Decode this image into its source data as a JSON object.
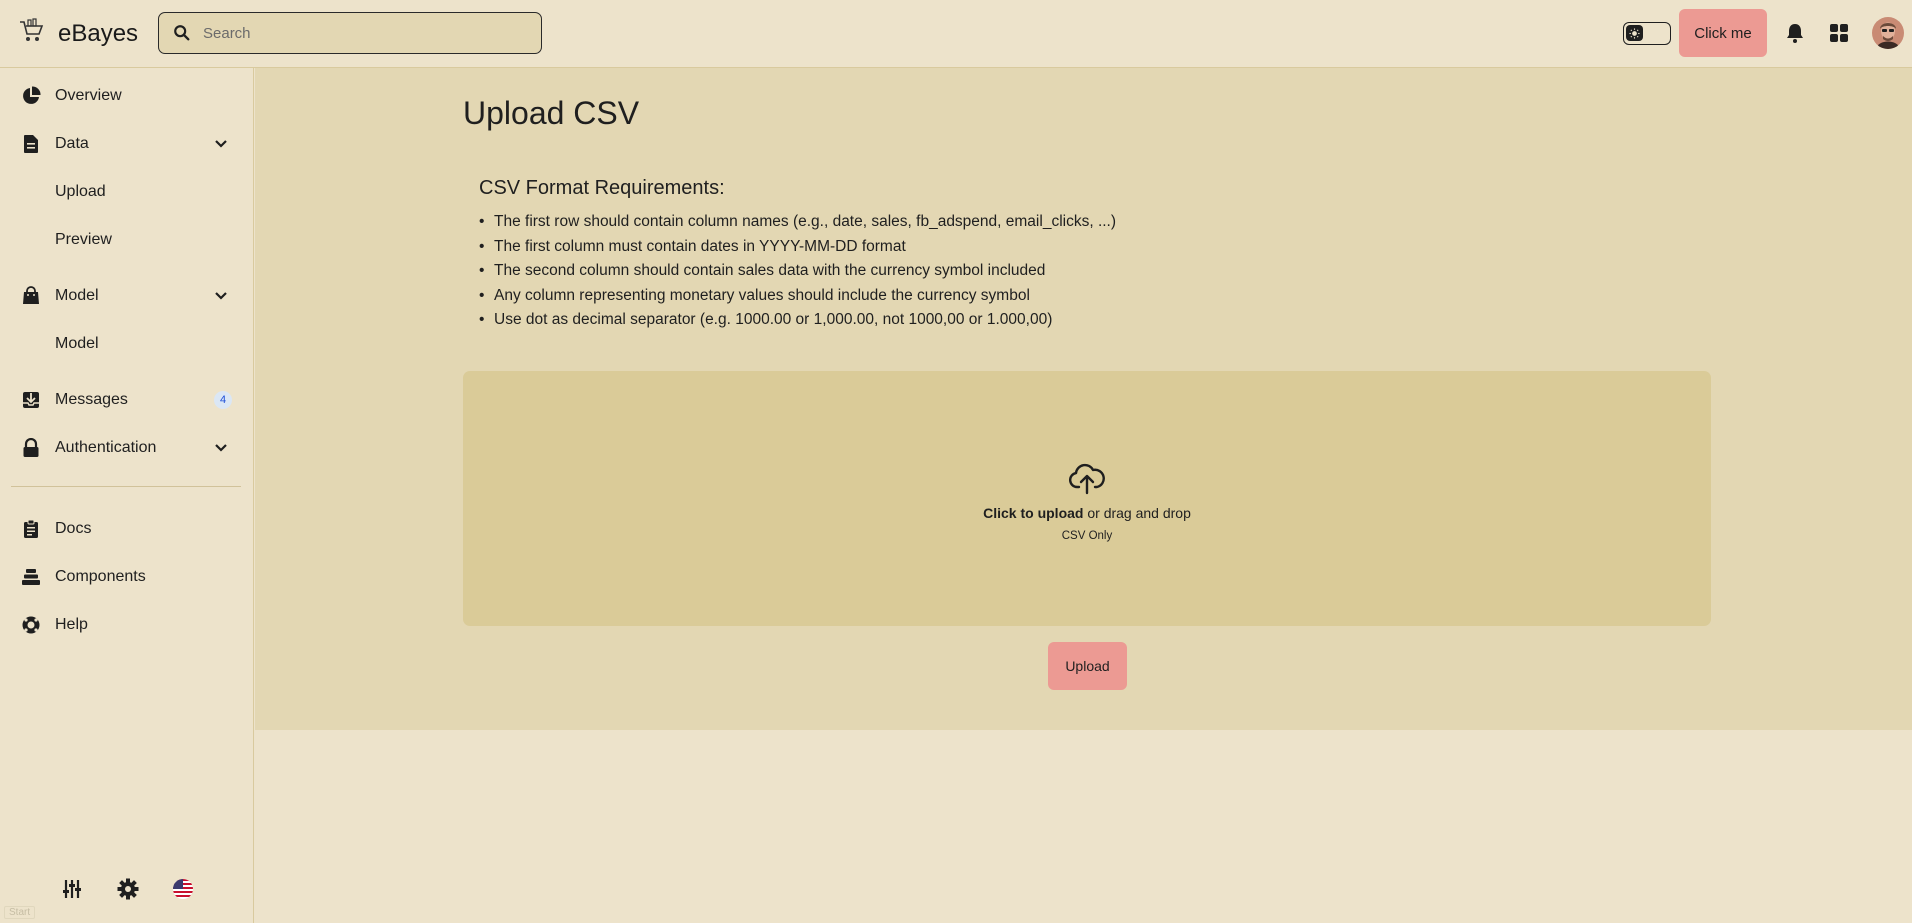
{
  "header": {
    "app_name": "eBayes",
    "search_placeholder": "Search",
    "click_button": "Click me"
  },
  "sidebar": {
    "overview": "Overview",
    "data": "Data",
    "data_children": [
      "Upload",
      "Preview"
    ],
    "model": "Model",
    "model_children": [
      "Model"
    ],
    "messages": "Messages",
    "messages_badge": "4",
    "authentication": "Authentication",
    "docs": "Docs",
    "components": "Components",
    "help": "Help",
    "start_label": "Start"
  },
  "main": {
    "title": "Upload CSV",
    "requirements_title": "CSV Format Requirements:",
    "requirements": [
      "The first row should contain column names (e.g., date, sales, fb_adspend, email_clicks, ...)",
      "The first column must contain dates in YYYY-MM-DD format",
      "The second column should contain sales data with the currency symbol included",
      "Any column representing monetary values should include the currency symbol",
      "Use dot as decimal separator (e.g. 1000.00 or 1,000.00, not 1000,00 or 1.000,00)"
    ],
    "dropzone": {
      "click_text": "Click to upload",
      "drag_text": " or drag and drop",
      "hint": "CSV Only"
    },
    "upload_button": "Upload"
  },
  "colors": {
    "background": "#ede3cb",
    "panel": "#e3d7b3",
    "dropzone": "#dacb98",
    "accent_button": "#ec9a93",
    "badge_bg": "#dbe7f5",
    "badge_text": "#1d4ed8"
  }
}
